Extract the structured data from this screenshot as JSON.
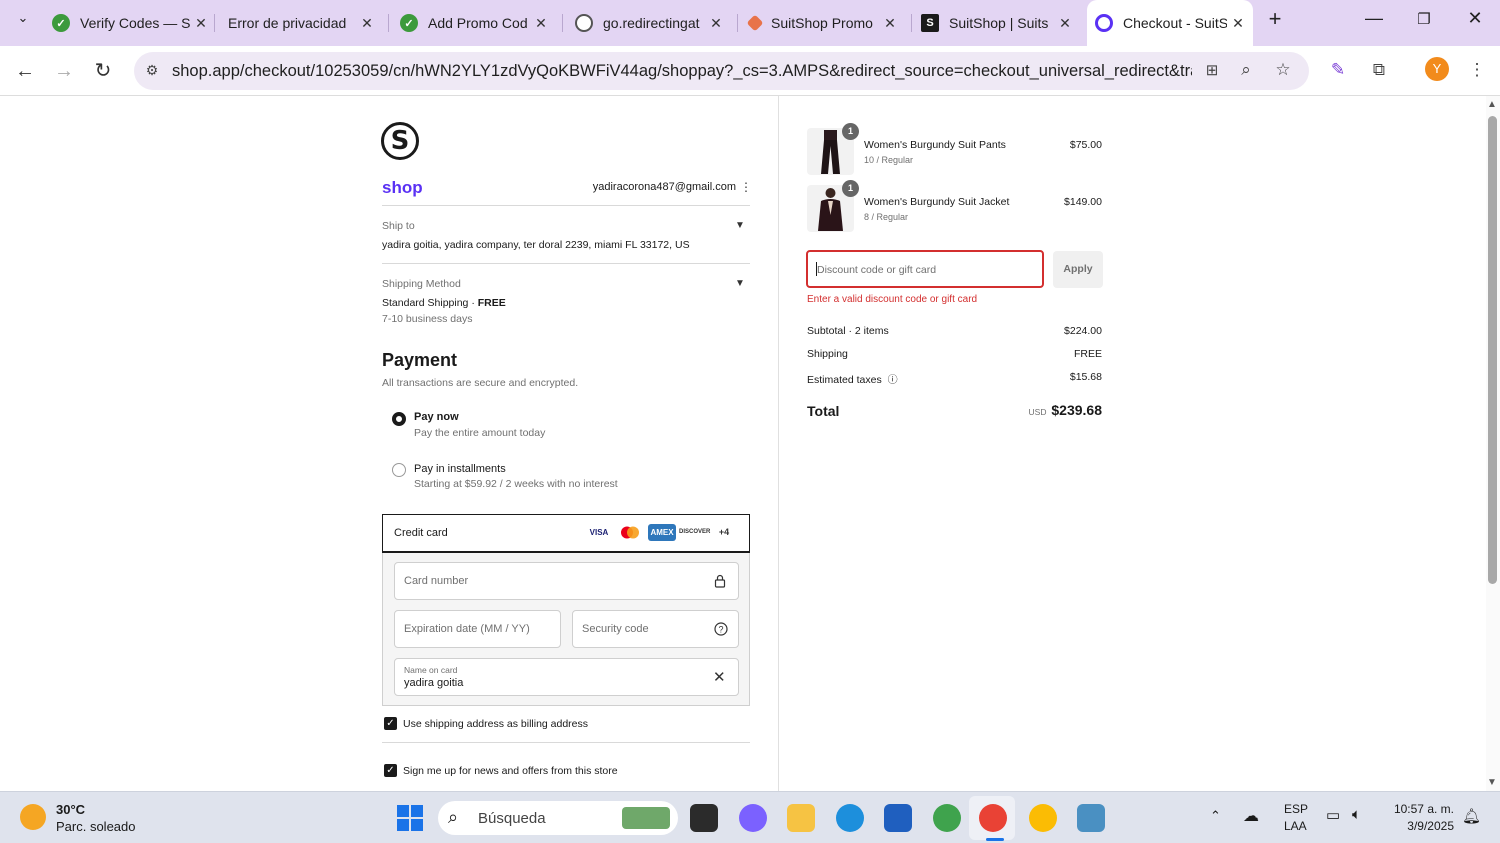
{
  "browser": {
    "tabs": [
      {
        "title": "Verify Codes — S",
        "active": false
      },
      {
        "title": "Error de privacidad",
        "active": false
      },
      {
        "title": "Add Promo Cod",
        "active": false
      },
      {
        "title": "go.redirectingat",
        "active": false
      },
      {
        "title": "SuitShop Promo",
        "active": false
      },
      {
        "title": "SuitShop | Suits",
        "active": false
      },
      {
        "title": "Checkout - SuitS",
        "active": true
      }
    ],
    "url": "shop.app/checkout/10253059/cn/hWN2YLY1zdVyQoKBWFiV44ag/shoppay?_cs=3.AMPS&redirect_source=checkout_universal_redirect&tracking_uni...",
    "avatar_letter": "Y",
    "accent_color": "#e3d5f3"
  },
  "checkout": {
    "logo_letter": "S",
    "shop_brand": "shop",
    "email": "yadiracorona487@gmail.com",
    "ship_to_label": "Ship to",
    "ship_to_value": "yadira goitia, yadira company, ter doral 2239, miami FL 33172, US",
    "shipping_method_label": "Shipping Method",
    "shipping_method_name": "Standard Shipping",
    "shipping_method_separator": "·",
    "shipping_method_price": "FREE",
    "shipping_method_eta": "7-10 business days",
    "payment_heading": "Payment",
    "payment_subtitle": "All transactions are secure and encrypted.",
    "options": [
      {
        "title": "Pay now",
        "subtitle": "Pay the entire amount today",
        "selected": true
      },
      {
        "title": "Pay in installments",
        "subtitle": "Starting at $59.92 / 2 weeks with no interest",
        "selected": false
      }
    ],
    "credit_card": {
      "title": "Credit card",
      "logos": [
        "VISA",
        "MC",
        "AMEX",
        "DISCOVER"
      ],
      "more": "+4",
      "card_number_placeholder": "Card number",
      "expiration_placeholder": "Expiration date (MM / YY)",
      "security_placeholder": "Security code",
      "name_label": "Name on card",
      "name_value": "yadira goitia"
    },
    "billing_checkbox": "Use shipping address as billing address",
    "news_checkbox": "Sign me up for news and offers from this store"
  },
  "order": {
    "items": [
      {
        "name": "Women's Burgundy Suit Pants",
        "variant": "10 / Regular",
        "price": "$75.00",
        "qty": "1"
      },
      {
        "name": "Women's Burgundy Suit Jacket",
        "variant": "8 / Regular",
        "price": "$149.00",
        "qty": "1"
      }
    ],
    "discount_placeholder": "Discount code or gift card",
    "apply_label": "Apply",
    "discount_error": "Enter a valid discount code or gift card",
    "subtotal_label": "Subtotal · 2 items",
    "subtotal_value": "$224.00",
    "shipping_label": "Shipping",
    "shipping_value": "FREE",
    "taxes_label": "Estimated taxes",
    "taxes_value": "$15.68",
    "total_label": "Total",
    "total_currency": "USD",
    "total_value": "$239.68",
    "error_color": "#d32f2f"
  },
  "taskbar": {
    "weather_temp": "30°C",
    "weather_desc": "Parc. soleado",
    "search_placeholder": "Búsqueda",
    "lang_top": "ESP",
    "lang_bottom": "LAA",
    "time": "10:57 a. m.",
    "date": "3/9/2025"
  }
}
